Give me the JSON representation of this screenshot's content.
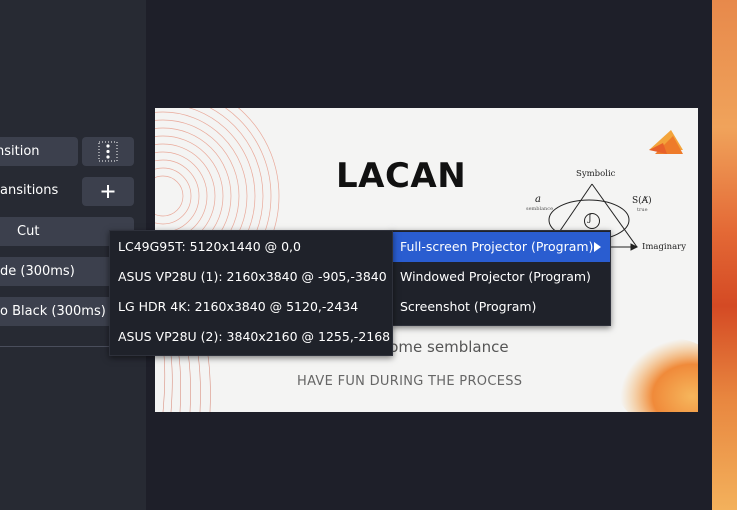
{
  "left_panel": {
    "transition_label": "nsition",
    "transitions_label": "ansitions",
    "cut_label": "Cut",
    "fade_label": "de (300ms)",
    "fade_black_label": "o Black (300ms)"
  },
  "preview": {
    "title": "LACAN",
    "diagram": {
      "symbolic": "Symbolic",
      "imaginary": "Imaginary",
      "a_label": "a",
      "semblance_small": "semblance",
      "s_label": "S(A̸)",
      "true_small": "true",
      "j_label": "J"
    },
    "lines": {
      "subtitle_partial": "come semblance",
      "footer": "HAVE FUN DURING THE PROCESS"
    }
  },
  "context_menu": {
    "items": [
      "Full-screen Projector (Program)",
      "Windowed Projector (Program)",
      "Screenshot (Program)"
    ]
  },
  "submenu": {
    "items": [
      "LC49G95T: 5120x1440 @ 0,0",
      "ASUS VP28U (1): 2160x3840 @ -905,-3840",
      "LG HDR 4K: 2160x3840 @ 5120,-2434",
      "ASUS VP28U (2): 3840x2160 @ 1255,-2168"
    ]
  }
}
